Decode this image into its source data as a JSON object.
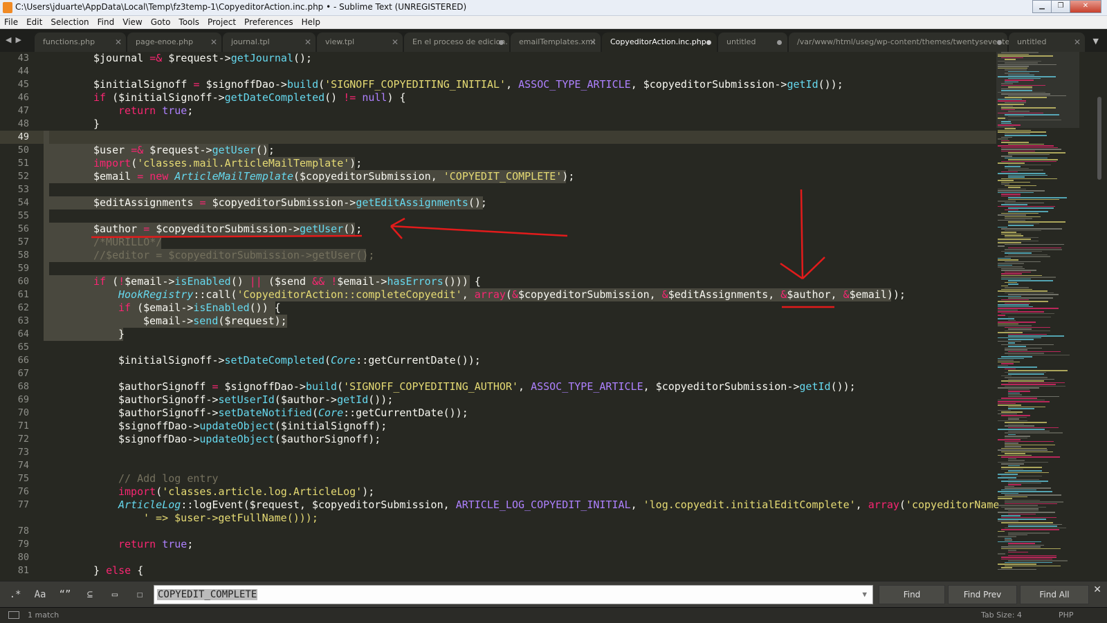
{
  "window": {
    "title": "C:\\Users\\jduarte\\AppData\\Local\\Temp\\fz3temp-1\\CopyeditorAction.inc.php • - Sublime Text (UNREGISTERED)",
    "minimize": "▁",
    "maximize": "❐",
    "close": "✕"
  },
  "menu": [
    "File",
    "Edit",
    "Selection",
    "Find",
    "View",
    "Goto",
    "Tools",
    "Project",
    "Preferences",
    "Help"
  ],
  "tabs": [
    {
      "label": "functions.php",
      "state": "close"
    },
    {
      "label": "page-enoe.php",
      "state": "close"
    },
    {
      "label": "journal.tpl",
      "state": "close"
    },
    {
      "label": "view.tpl",
      "state": "close"
    },
    {
      "label": "En el proceso de edicion.",
      "state": "dirty"
    },
    {
      "label": "emailTemplates.xml",
      "state": "close"
    },
    {
      "label": "CopyeditorAction.inc.php",
      "state": "dirty",
      "active": true
    },
    {
      "label": "untitled",
      "state": "dirty"
    },
    {
      "label": "/var/www/html/useg/wp-content/themes/twentysevente",
      "state": "dirty"
    },
    {
      "label": "untitled",
      "state": "close"
    }
  ],
  "editor": {
    "current_line": 49,
    "line_numbers": [
      43,
      44,
      45,
      46,
      47,
      48,
      49,
      50,
      51,
      52,
      53,
      54,
      55,
      56,
      57,
      58,
      59,
      60,
      61,
      62,
      63,
      64,
      65,
      66,
      67,
      68,
      69,
      70,
      71,
      72,
      73,
      74,
      75,
      76,
      77,
      "",
      78,
      79,
      80,
      81
    ],
    "code": [
      "\t\t$journal =& $request->getJournal();",
      "",
      "\t\t$initialSignoff = $signoffDao->build('SIGNOFF_COPYEDITING_INITIAL', ASSOC_TYPE_ARTICLE, $copyeditorSubmission->getId());",
      "\t\tif ($initialSignoff->getDateCompleted() != null) {",
      "\t\t\treturn true;",
      "\t\t}",
      "",
      "\t\t$user =& $request->getUser();",
      "\t\timport('classes.mail.ArticleMailTemplate');",
      "\t\t$email = new ArticleMailTemplate($copyeditorSubmission, 'COPYEDIT_COMPLETE');",
      "",
      "\t\t$editAssignments = $copyeditorSubmission->getEditAssignments();",
      "",
      "\t\t$author = $copyeditorSubmission->getUser();",
      "\t\t/*MURILLO*/",
      "\t\t//$editor = $copyeditorSubmission->getUser();",
      "",
      "\t\tif (!$email->isEnabled() || ($send && !$email->hasErrors())) {",
      "\t\t\tHookRegistry::call('CopyeditorAction::completeCopyedit', array(&$copyeditorSubmission, &$editAssignments, &$author, &$email));",
      "\t\t\tif ($email->isEnabled()) {",
      "\t\t\t\t$email->send($request);",
      "\t\t\t}",
      "",
      "\t\t\t$initialSignoff->setDateCompleted(Core::getCurrentDate());",
      "",
      "\t\t\t$authorSignoff = $signoffDao->build('SIGNOFF_COPYEDITING_AUTHOR', ASSOC_TYPE_ARTICLE, $copyeditorSubmission->getId());",
      "\t\t\t$authorSignoff->setUserId($author->getId());",
      "\t\t\t$authorSignoff->setDateNotified(Core::getCurrentDate());",
      "\t\t\t$signoffDao->updateObject($initialSignoff);",
      "\t\t\t$signoffDao->updateObject($authorSignoff);",
      "",
      "",
      "\t\t\t// Add log entry",
      "\t\t\timport('classes.article.log.ArticleLog');",
      "\t\t\tArticleLog::logEvent($request, $copyeditorSubmission, ARTICLE_LOG_COPYEDIT_INITIAL, 'log.copyedit.initialEditComplete', array('copyeditorName",
      "\t\t\t\t' => $user->getFullName()));",
      "",
      "\t\t\treturn true;",
      "",
      "\t\t} else {"
    ]
  },
  "find_panel": {
    "regex_toggle": ".*",
    "case_toggle": "Aa",
    "word_toggle": "“”",
    "in_selection_toggle": "⊆",
    "highlight_toggle": "▭",
    "context_toggle": "☐",
    "query": "COPYEDIT_COMPLETE",
    "find_label": "Find",
    "find_prev_label": "Find Prev",
    "find_all_label": "Find All",
    "close": "✕"
  },
  "status": {
    "matches": "1 match",
    "tab_size": "Tab Size: 4",
    "syntax": "PHP"
  },
  "colors": {
    "editor_bg": "#272822",
    "keyword": "#f92672",
    "function": "#66d9ef",
    "string": "#e6db74",
    "constant": "#ae81ff",
    "comment": "#75715e",
    "annotation": "#e21b1b"
  }
}
